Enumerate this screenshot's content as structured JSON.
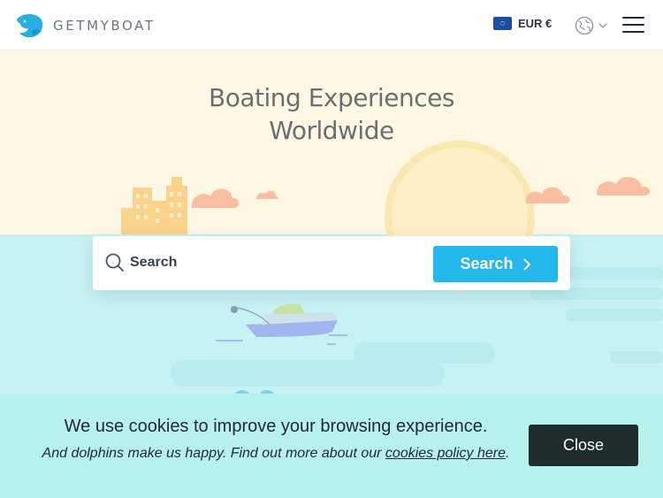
{
  "header": {
    "logo_text": "GETMYBOAT",
    "currency_label": "EUR €",
    "language_icon": "globe-icon",
    "menu_icon": "hamburger-icon"
  },
  "hero": {
    "title_line1": "Boating Experiences",
    "title_line2": "Worldwide"
  },
  "search": {
    "placeholder": "Search",
    "button_label": "Search"
  },
  "cookie_banner": {
    "title": "We use cookies to improve your browsing experience.",
    "text_before_link": "And dolphins make us happy. Find out more about our ",
    "link_text": "cookies policy here",
    "text_after_link": ".",
    "close_label": "Close"
  },
  "colors": {
    "accent": "#24b7ec",
    "sky": "#fdf7e4",
    "sea": "#c7f2f3",
    "cookie_bg": "#b6f1ee",
    "close_bg": "#1f2c2c"
  }
}
